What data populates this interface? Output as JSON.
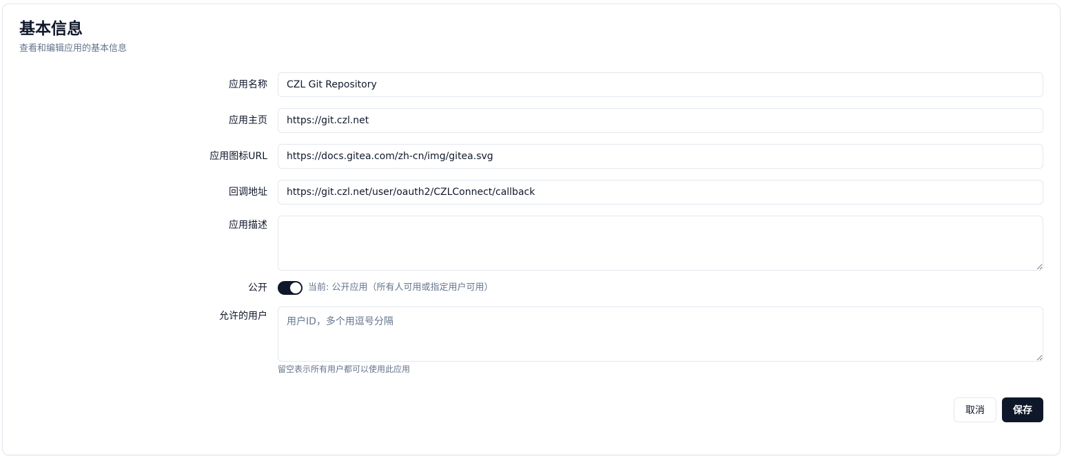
{
  "section": {
    "title": "基本信息",
    "subtitle": "查看和编辑应用的基本信息"
  },
  "form": {
    "app_name": {
      "label": "应用名称",
      "value": "CZL Git Repository"
    },
    "homepage": {
      "label": "应用主页",
      "value": "https://git.czl.net"
    },
    "icon_url": {
      "label": "应用图标URL",
      "value": "https://docs.gitea.com/zh-cn/img/gitea.svg"
    },
    "callback_url": {
      "label": "回调地址",
      "value": "https://git.czl.net/user/oauth2/CZLConnect/callback"
    },
    "description": {
      "label": "应用描述",
      "value": ""
    },
    "public": {
      "label": "公开",
      "enabled": true,
      "status_text": "当前: 公开应用（所有人可用或指定用户可用）"
    },
    "allowed_users": {
      "label": "允许的用户",
      "value": "",
      "placeholder": "用户ID，多个用逗号分隔",
      "hint": "留空表示所有用户都可以使用此应用"
    }
  },
  "actions": {
    "cancel_label": "取消",
    "save_label": "保存"
  },
  "colors": {
    "primary": "#0f172a",
    "muted_text": "#64748b",
    "border": "#e2e8f0"
  }
}
